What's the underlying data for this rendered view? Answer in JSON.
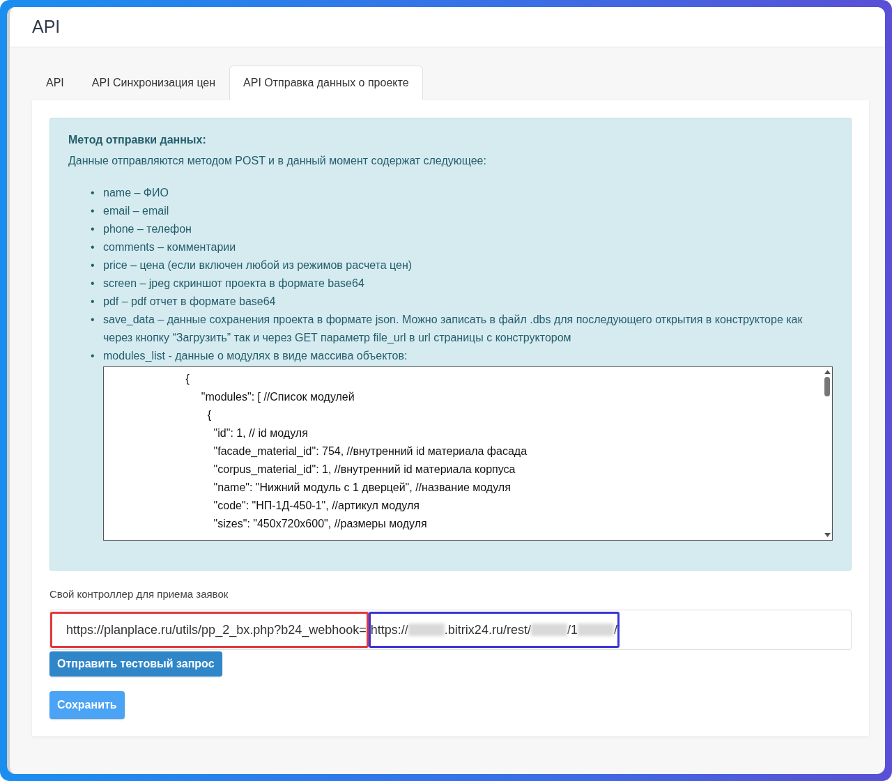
{
  "page": {
    "title": "API"
  },
  "tabs": [
    {
      "label": "API",
      "selected": false
    },
    {
      "label": "API Синхронизация цен",
      "selected": false
    },
    {
      "label": "API Отправка данных о проекте",
      "selected": true
    }
  ],
  "info": {
    "heading": "Метод отправки данных:",
    "intro": "Данные отправляются методом POST и в данный момент содержат следующее:",
    "items": [
      {
        "bullet": "•",
        "text": "name – ФИО"
      },
      {
        "bullet": "•",
        "text": "email – email"
      },
      {
        "bullet": "•",
        "text": "phone – телефон"
      },
      {
        "bullet": "•",
        "text": "comments – комментарии"
      },
      {
        "bullet": "•",
        "text": "price – цена (если включен любой из режимов расчета цен)"
      },
      {
        "bullet": "•",
        "text": "screen – jpeg скриншот проекта в формате base64"
      },
      {
        "bullet": "•",
        "text": "pdf – pdf отчет в формате base64"
      },
      {
        "bullet": "•",
        "text": "save_data – данные сохранения проекта в формате json. Можно записать в файл .dbs для последующего открытия в конструкторе как через кнопку “Загрузить” так и через GET параметр file_url в url страницы с конструктором"
      },
      {
        "bullet": "•",
        "text": "modules_list - данные о модулях в виде массива объектов:"
      }
    ],
    "code_lines": [
      "                          {",
      "                               \"modules\": [ //Список модулей",
      "                                 {",
      "                                   \"id\": 1, // id модуля",
      "                                   \"facade_material_id\": 754, //внутренний id материала фасада",
      "                                   \"corpus_material_id\": 1, //внутренний id материала корпуса",
      "                                   \"name\": \"Нижний модуль с 1 дверцей\", //название модуля",
      "                                   \"code\": \"НП-1Д-450-1\", //артикул модуля",
      "                                   \"sizes\": \"450x720x600\", //размеры модуля"
    ]
  },
  "controller": {
    "label": "Свой контроллер для приема заявок",
    "segments": [
      {
        "color": "#e0393e",
        "parts": [
          {
            "kind": "text",
            "text": "https://planplace.ru/utils/pp_2_bx.php?b24_webhook="
          }
        ]
      },
      {
        "color": "#3a35d8",
        "parts": [
          {
            "kind": "text",
            "text": "https://"
          },
          {
            "kind": "blur"
          },
          {
            "kind": "text",
            "text": ".bitrix24.ru/rest/"
          },
          {
            "kind": "blur"
          },
          {
            "kind": "text",
            "text": "/1"
          },
          {
            "kind": "blur"
          },
          {
            "kind": "text",
            "text": "/"
          }
        ]
      }
    ]
  },
  "buttons": [
    {
      "label": "Отправить тестовый запрос",
      "kind": "secondary"
    },
    {
      "label": "Сохранить",
      "kind": "primary"
    }
  ]
}
